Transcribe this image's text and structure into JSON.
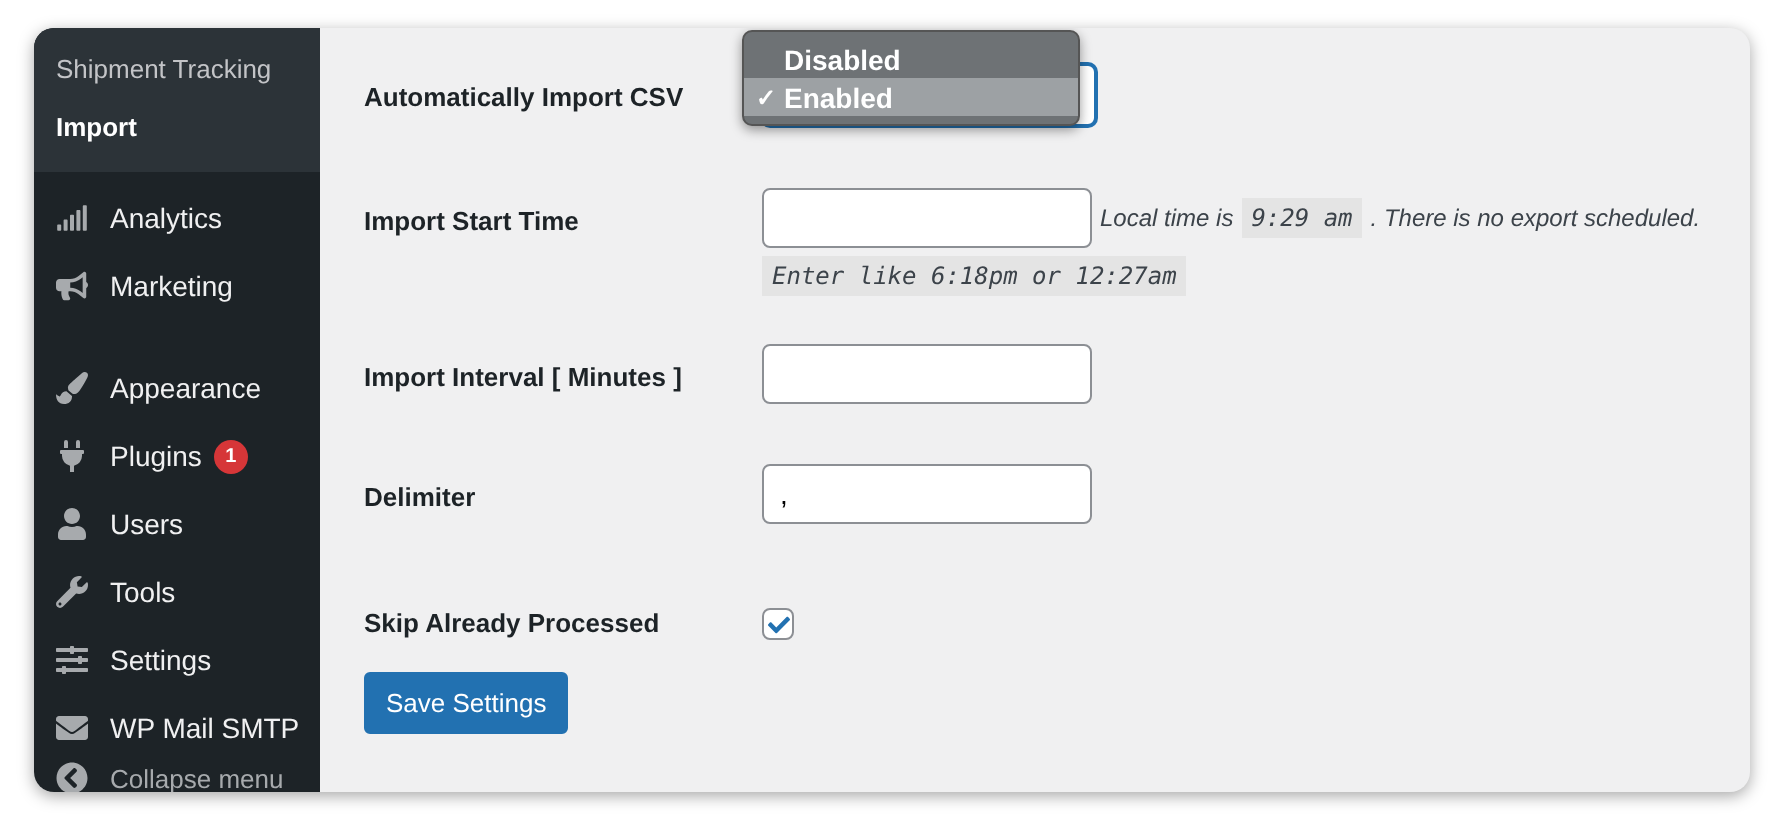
{
  "sidebar": {
    "submenu": [
      {
        "label": "Shipment Tracking",
        "selected": false
      },
      {
        "label": "Import",
        "selected": true
      }
    ],
    "menu_groups": [
      [
        {
          "label": "Analytics"
        },
        {
          "label": "Marketing"
        }
      ],
      [
        {
          "label": "Appearance"
        },
        {
          "label": "Plugins",
          "badge": "1"
        },
        {
          "label": "Users"
        },
        {
          "label": "Tools"
        },
        {
          "label": "Settings"
        },
        {
          "label": "WP Mail SMTP"
        }
      ]
    ],
    "collapse": "Collapse menu"
  },
  "form": {
    "fields": [
      {
        "kind": "select",
        "label": "Automatically Import CSV",
        "expanded": true,
        "options": [
          {
            "label": "Disabled",
            "selected": false
          },
          {
            "label": "Enabled",
            "selected": true
          }
        ],
        "check_mark": "✓"
      },
      {
        "kind": "time",
        "label": "Import Start Time",
        "note_before": "Local time is",
        "local_time": "9:29 am",
        "note_after": ". There is no export scheduled.",
        "hint": "Enter like 6:18pm or 12:27am"
      },
      {
        "kind": "text",
        "label": "Import Interval [ Minutes ]"
      },
      {
        "kind": "text",
        "label": "Delimiter",
        "value": ","
      },
      {
        "kind": "checkbox",
        "label": "Skip Already Processed",
        "checked": true
      }
    ],
    "submit": "Save Settings"
  }
}
